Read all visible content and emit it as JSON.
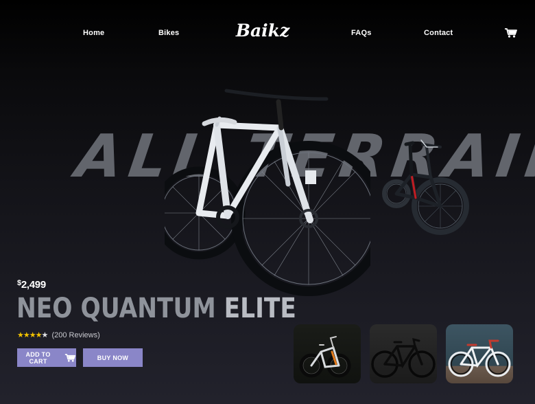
{
  "brand": {
    "logo": "Baikz"
  },
  "nav": {
    "items": [
      "Home",
      "Bikes",
      "FAQs",
      "Contact"
    ]
  },
  "hero": {
    "background_text": "ALL TERRAIN"
  },
  "product": {
    "currency": "$",
    "price": "2,499",
    "name_part1": "NEO QUANTUM ",
    "name_part2": "ELITE",
    "stars": "★★★★",
    "stars_off": "★",
    "reviews": "(200 Reviews)"
  },
  "buttons": {
    "add_to_cart": "ADD TO CART",
    "buy_now": "BUY NOW"
  },
  "colors": {
    "accent": "#8a86c8",
    "star": "#f2c200",
    "background": "#16161c"
  },
  "icons": [
    "cart-icon",
    "bicycle-icon",
    "star-icon"
  ],
  "thumbnails": [
    "mountain-bike-thumbnail",
    "road-bike-thumbnail",
    "fixie-bike-thumbnail"
  ]
}
